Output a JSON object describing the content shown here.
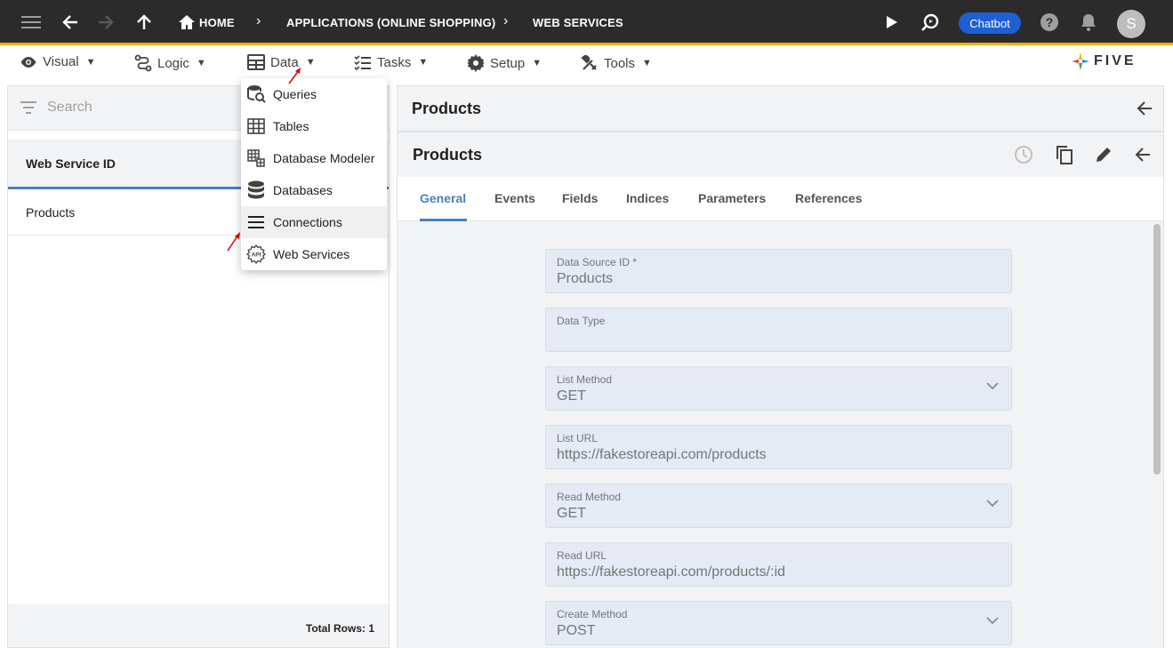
{
  "topbar": {
    "breadcrumbs": [
      "HOME",
      "APPLICATIONS (ONLINE SHOPPING)",
      "WEB SERVICES"
    ],
    "chatbot_label": "Chatbot",
    "avatar_initial": "S",
    "background": "#2b2b2b",
    "accent": "#f4b400"
  },
  "menubar": {
    "items": [
      {
        "label": "Visual",
        "icon": "eye-icon"
      },
      {
        "label": "Logic",
        "icon": "logic-icon"
      },
      {
        "label": "Data",
        "icon": "table-icon"
      },
      {
        "label": "Tasks",
        "icon": "tasks-icon"
      },
      {
        "label": "Setup",
        "icon": "gear-icon"
      },
      {
        "label": "Tools",
        "icon": "tools-icon"
      }
    ],
    "caret": "▼",
    "logo_text": "FIVE"
  },
  "left_panel": {
    "search_placeholder": "Search",
    "column_header": "Web Service ID",
    "rows": [
      "Products"
    ],
    "footer": "Total Rows: 1"
  },
  "data_menu": {
    "items": [
      {
        "label": "Queries",
        "icon": "queries-icon"
      },
      {
        "label": "Tables",
        "icon": "tables-icon"
      },
      {
        "label": "Database Modeler",
        "icon": "database-modeler-icon"
      },
      {
        "label": "Databases",
        "icon": "databases-icon"
      },
      {
        "label": "Connections",
        "icon": "connections-icon"
      },
      {
        "label": "Web Services",
        "icon": "web-services-icon"
      }
    ],
    "highlighted": "Connections"
  },
  "right_panel": {
    "outer_title": "Products",
    "inner_title": "Products",
    "tabs": [
      "General",
      "Events",
      "Fields",
      "Indices",
      "Parameters",
      "References"
    ],
    "active_tab": "General",
    "fields": [
      {
        "label": "Data Source ID *",
        "value": "Products",
        "dropdown": false
      },
      {
        "label": "Data Type",
        "value": "",
        "dropdown": false
      },
      {
        "label": "List Method",
        "value": "GET",
        "dropdown": true
      },
      {
        "label": "List URL",
        "value": "https://fakestoreapi.com/products",
        "dropdown": false
      },
      {
        "label": "Read Method",
        "value": "GET",
        "dropdown": true
      },
      {
        "label": "Read URL",
        "value": "https://fakestoreapi.com/products/:id",
        "dropdown": false
      },
      {
        "label": "Create Method",
        "value": "POST",
        "dropdown": true
      }
    ],
    "accent": "#4a7fc1"
  }
}
